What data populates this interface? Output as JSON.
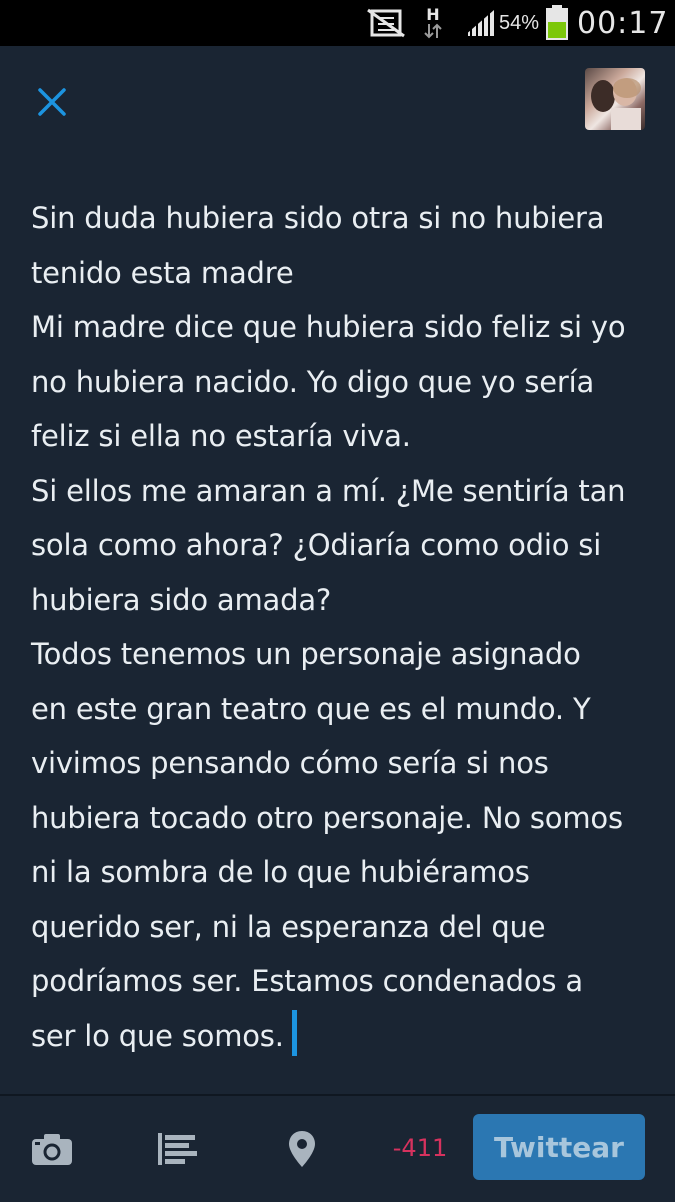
{
  "status_bar": {
    "battery_percent": "54%",
    "time": "00:17",
    "network_letter": "H",
    "icons": [
      "vibrate-muted-icon",
      "network-h-icon",
      "signal-icon",
      "battery-icon"
    ]
  },
  "header": {
    "close_icon": "close-icon",
    "avatar_alt": "profile photo"
  },
  "compose": {
    "text": "Sin duda hubiera sido otra si no hubiera\ntenido esta madre\nMi madre dice que hubiera sido feliz si yo\nno hubiera nacido. Yo digo que yo sería\nfeliz si ella no estaría viva.\nSi ellos me amaran a mí. ¿Me sentiría tan\nsola como ahora? ¿Odiaría como odio si\nhubiera sido amada?\nTodos tenemos un personaje asignado\nen este gran teatro que es el mundo. Y\nvivimos pensando cómo sería si nos\nhubiera tocado otro personaje. No somos\nni la sombra de lo que hubiéramos\nquerido ser, ni la esperanza del que\npodríamos ser. Estamos condenados a\nser lo que somos."
  },
  "toolbar": {
    "icons": [
      "camera-icon",
      "list-icon",
      "location-pin-icon"
    ],
    "char_count": "-411",
    "tweet_button_label": "Twittear"
  },
  "colors": {
    "background": "#1a2533",
    "accent": "#1c94e0",
    "count_negative": "#d6325e",
    "button_bg": "#2b77b2"
  }
}
